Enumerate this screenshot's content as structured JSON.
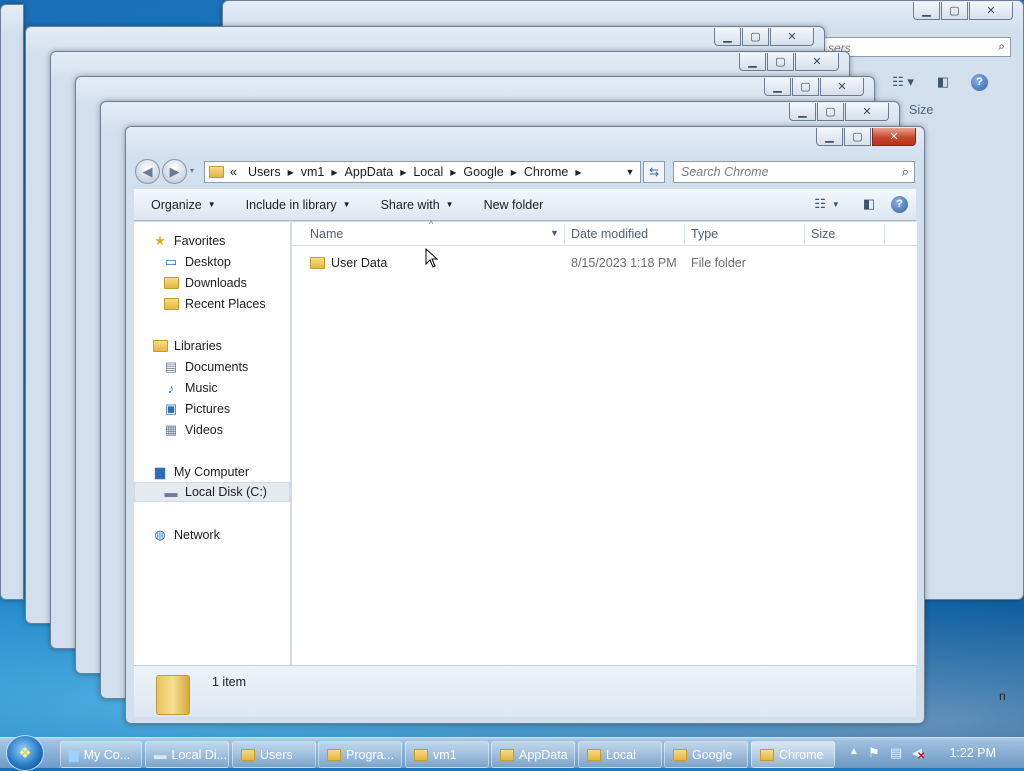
{
  "window": {
    "address_overflow": "«",
    "breadcrumb": [
      "Users",
      "vm1",
      "AppData",
      "Local",
      "Google",
      "Chrome"
    ],
    "search_placeholder": "Search Chrome",
    "caption": {
      "minimize": "▁",
      "maximize": "▢",
      "close": "✕"
    }
  },
  "background_windows": {
    "search_fragment": "sers",
    "col_size": "Size",
    "edge_text": "n"
  },
  "toolbar": {
    "organize": "Organize",
    "include_in_library": "Include in library",
    "share_with": "Share with",
    "new_folder": "New folder"
  },
  "nav": {
    "favorites": "Favorites",
    "desktop": "Desktop",
    "downloads": "Downloads",
    "recent_places": "Recent Places",
    "libraries": "Libraries",
    "documents": "Documents",
    "music": "Music",
    "pictures": "Pictures",
    "videos": "Videos",
    "my_computer": "My Computer",
    "local_disk": "Local Disk (C:)",
    "network": "Network"
  },
  "columns": {
    "name": "Name",
    "date_modified": "Date modified",
    "type": "Type",
    "size": "Size"
  },
  "files": [
    {
      "name": "User Data",
      "date_modified": "8/15/2023 1:18 PM",
      "type": "File folder",
      "size": ""
    }
  ],
  "details": {
    "count": "1 item"
  },
  "taskbar": {
    "items": [
      "My Co...",
      "Local Di...",
      "Users",
      "Progra...",
      "vm1",
      "AppData",
      "Local",
      "Google",
      "Chrome"
    ],
    "active": "Chrome",
    "clock": "1:22 PM"
  },
  "colors": {
    "close_button": "#c9482d",
    "accent": "#2c6fb6"
  }
}
